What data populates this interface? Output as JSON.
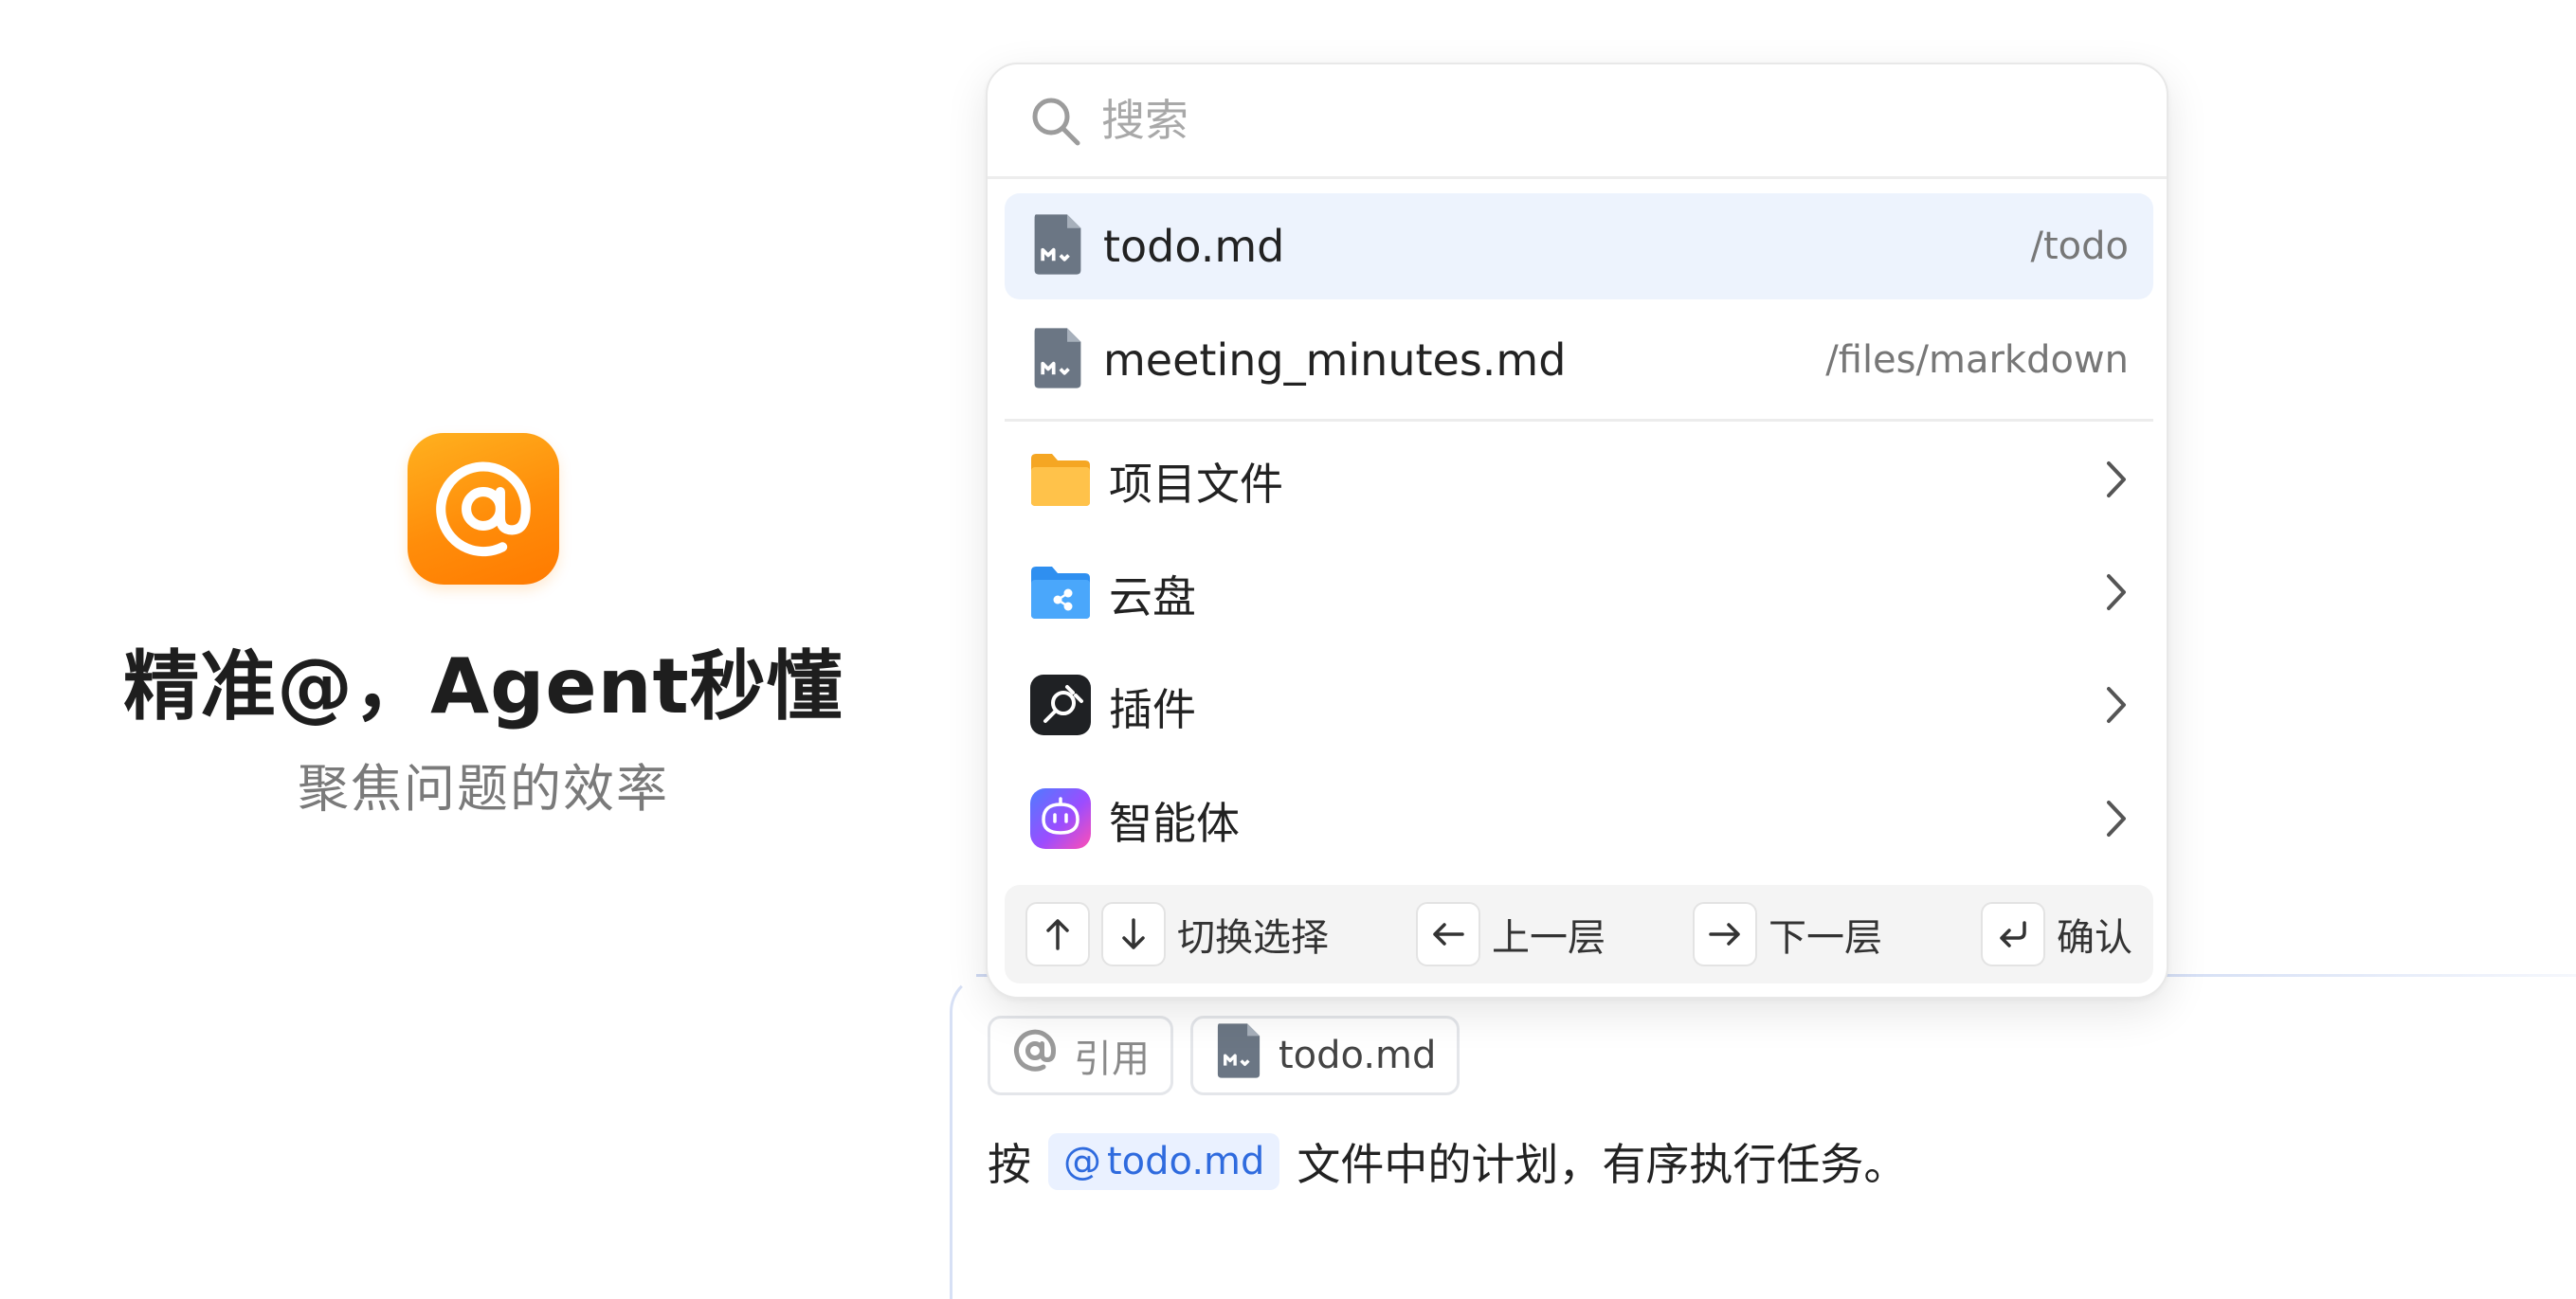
{
  "hero": {
    "title": "精准@，Agent秒懂",
    "subtitle": "聚焦问题的效率",
    "icon": "at-sign-icon",
    "accent": "#ff8d0a"
  },
  "popup": {
    "search": {
      "placeholder": "搜索",
      "value": ""
    },
    "files": [
      {
        "name": "todo.md",
        "path": "/todo",
        "icon": "markdown-file-icon",
        "selected": true
      },
      {
        "name": "meeting_minutes.md",
        "path": "/files/markdown",
        "icon": "markdown-file-icon",
        "selected": false
      }
    ],
    "categories": [
      {
        "label": "项目文件",
        "icon": "folder-icon"
      },
      {
        "label": "云盘",
        "icon": "cloud-drive-folder-icon"
      },
      {
        "label": "插件",
        "icon": "plugin-icon"
      },
      {
        "label": "智能体",
        "icon": "agent-bot-icon"
      }
    ],
    "footer": {
      "switch_label": "切换选择",
      "up_label": "上一层",
      "down_label": "下一层",
      "confirm_label": "确认"
    }
  },
  "composer": {
    "quote_label": "引用",
    "attached_file": "todo.md",
    "text_before": "按",
    "mention": "todo.md",
    "text_after": "文件中的计划，有序执行任务。"
  }
}
